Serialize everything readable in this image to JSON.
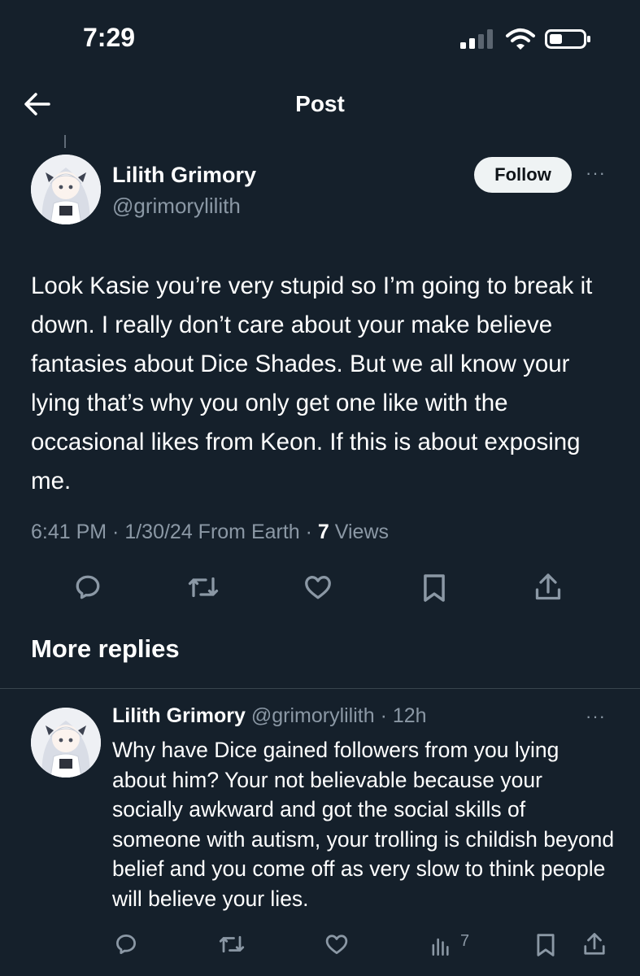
{
  "status_bar": {
    "time": "7:29"
  },
  "nav": {
    "title": "Post"
  },
  "main_post": {
    "author_name": "Lilith Grimory",
    "handle": "@grimorylilith",
    "follow_label": "Follow",
    "more_label": "···",
    "text": "Look Kasie you’re very stupid so I’m going to break it down. I really don’t care about your make believe fantasies about Dice Shades. But we all know your lying that’s why you only get one like with the occasional likes from Keon. If this is about exposing me.",
    "timestamp": "6:41 PM · 1/30/24 From Earth · ",
    "views_count": "7",
    "views_label": " Views",
    "actions": [
      "reply-icon",
      "retweet-icon",
      "like-icon",
      "bookmark-icon",
      "share-icon"
    ]
  },
  "more_replies": {
    "title": "More replies"
  },
  "reply": {
    "author_name": "Lilith Grimory",
    "handle": "@grimorylilith",
    "time": " · 12h",
    "more_label": "···",
    "text": "Why have Dice gained followers from you lying about him? Your not believable because your socially awkward and got the social skills of someone with autism, your trolling is childish beyond belief and you come off as very slow to think people will believe your lies.",
    "views": "7",
    "actions": [
      "reply-icon",
      "retweet-icon",
      "like-icon",
      "views-icon",
      "bookmark-icon",
      "share-icon"
    ]
  },
  "colors": {
    "background": "#15202b",
    "text": "#ffffff",
    "secondary_text": "#8b98a5",
    "divider": "#38444d",
    "follow_button_bg": "#eff3f4"
  }
}
